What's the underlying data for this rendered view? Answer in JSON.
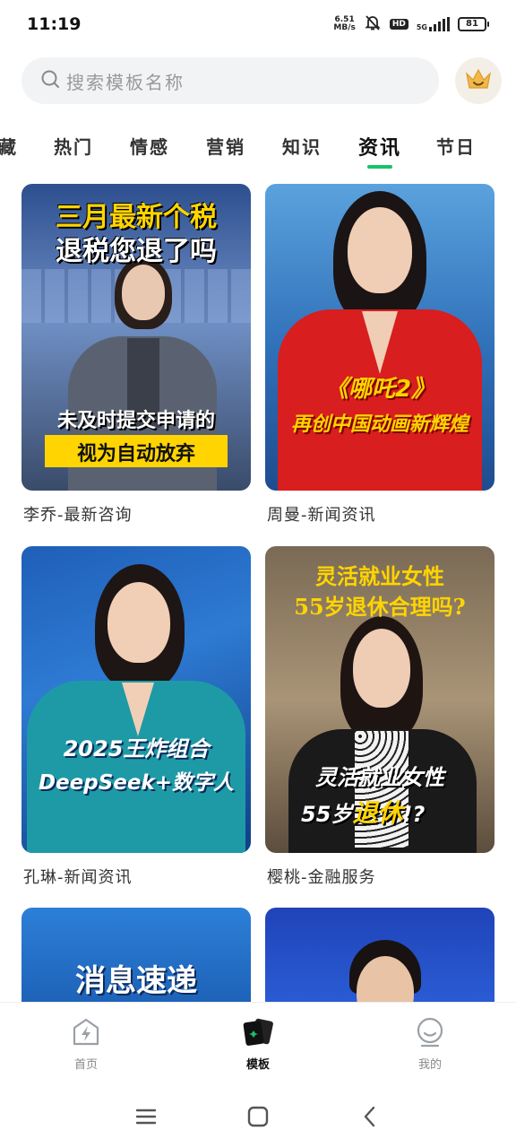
{
  "status": {
    "time": "11:19",
    "net_speed_value": "6.51",
    "net_speed_unit": "MB/s",
    "hd_label": "HD",
    "network": "5G",
    "battery": "81"
  },
  "search": {
    "placeholder": "搜索模板名称"
  },
  "tabs": [
    {
      "label": "藏"
    },
    {
      "label": "热门"
    },
    {
      "label": "情感"
    },
    {
      "label": "营销"
    },
    {
      "label": "知识"
    },
    {
      "label": "资讯"
    },
    {
      "label": "节日"
    }
  ],
  "active_tab": "资讯",
  "accent_color": "#19c26a",
  "cards": [
    {
      "title": "李乔-最新咨询",
      "caption_top_1": "三月最新个税",
      "caption_top_2": "退税您退了吗",
      "caption_bottom_1": "未及时提交申请的",
      "caption_bottom_2": "视为自动放弃"
    },
    {
      "title": "周曼-新闻资讯",
      "caption_1": "《哪吒2》",
      "caption_2": "再创中国动画新辉煌"
    },
    {
      "title": "孔琳-新闻资讯",
      "caption_1": "2025王炸组合",
      "caption_2": "DeepSeek+数字人"
    },
    {
      "title": "樱桃-金融服务",
      "caption_top_1": "灵活就业女性",
      "caption_top_2": "55岁退休合理吗?",
      "caption_bottom_1": "灵活就业女性",
      "caption_bottom_2a": "55岁",
      "caption_bottom_2b": "退休",
      "caption_bottom_2c": "!?"
    },
    {
      "caption_1": "消息速递"
    },
    {}
  ],
  "bottom_nav": [
    {
      "label": "首页",
      "icon": "lightning-home-icon"
    },
    {
      "label": "模板",
      "icon": "template-cards-icon"
    },
    {
      "label": "我的",
      "icon": "profile-smile-icon"
    }
  ]
}
